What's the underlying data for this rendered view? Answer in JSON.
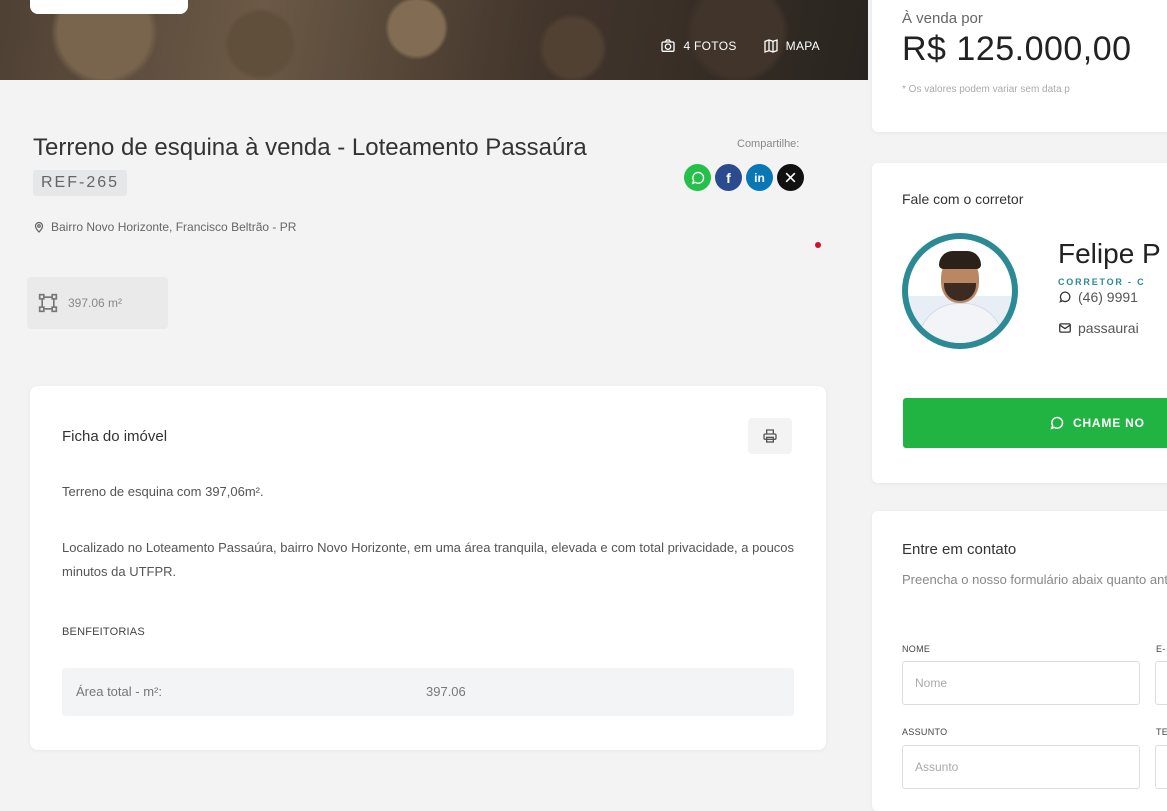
{
  "hero": {
    "photos_label": "4 FOTOS",
    "map_label": "MAPA"
  },
  "listing": {
    "title": "Terreno de esquina à venda - Loteamento Passaúra",
    "ref": "REF-265",
    "location": "Bairro Novo Horizonte, Francisco Beltrão - PR",
    "area": "397.06 m²"
  },
  "share": {
    "label": "Compartilhe:"
  },
  "ficha": {
    "title": "Ficha do imóvel",
    "paragraph1": "Terreno de esquina com 397,06m².",
    "paragraph2": "Localizado no Loteamento Passaúra, bairro Novo Horizonte, em uma área tranquila, elevada e com total privacidade, a poucos minutos da UTFPR.",
    "benfeitorias_label": "BENFEITORIAS",
    "features": [
      {
        "label": "Área total - m²:",
        "value": "397.06"
      }
    ]
  },
  "price": {
    "label": "À venda por",
    "value": "R$ 125.000,00",
    "note": "* Os valores podem variar sem data p"
  },
  "agent": {
    "section_title": "Fale com o corretor",
    "name": "Felipe P",
    "role": "CORRETOR - C",
    "phone": "(46) 9991",
    "email": "passaurai",
    "cta": "CHAME NO"
  },
  "contact_form": {
    "title": "Entre em contato",
    "description": "Preencha o nosso formulário abaix quanto antes:",
    "name_label": "NOME",
    "name_placeholder": "Nome",
    "email_label": "E-",
    "subject_label": "ASSUNTO",
    "subject_placeholder": "Assunto",
    "phone_label": "TE"
  },
  "colors": {
    "whatsapp": "#25c04a",
    "facebook": "#2b4b8f",
    "linkedin": "#0a77b5",
    "x": "#111111",
    "cta_green": "#22b443",
    "accent_teal": "#2c8a95"
  }
}
